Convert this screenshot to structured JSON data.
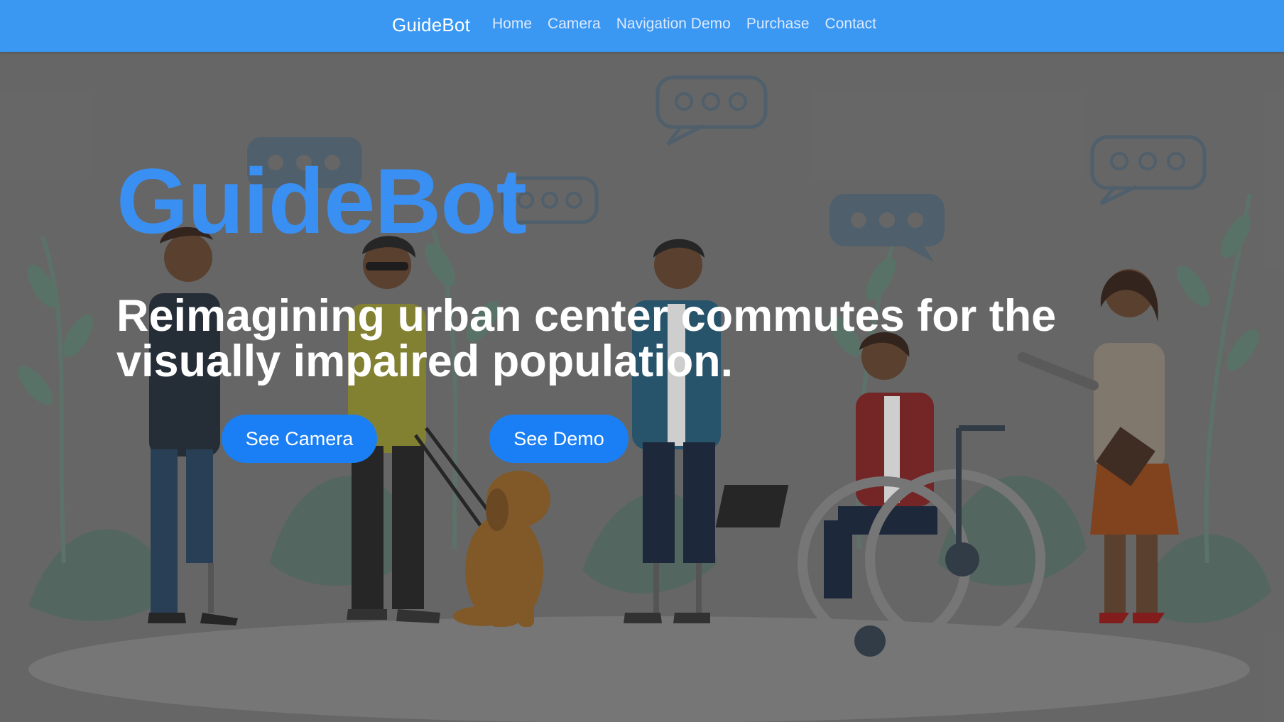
{
  "nav": {
    "brand": "GuideBot",
    "links": [
      "Home",
      "Camera",
      "Navigation Demo",
      "Purchase",
      "Contact"
    ]
  },
  "hero": {
    "title": "GuideBot",
    "subtitle": "Reimagining urban center commutes for the visually impaired population.",
    "buttons": {
      "camera": "See Camera",
      "demo": "See Demo"
    }
  },
  "colors": {
    "navbar": "#3a97f2",
    "title": "#3a8ff2",
    "button": "#1a7ff4",
    "background": "#6b6b6b"
  }
}
